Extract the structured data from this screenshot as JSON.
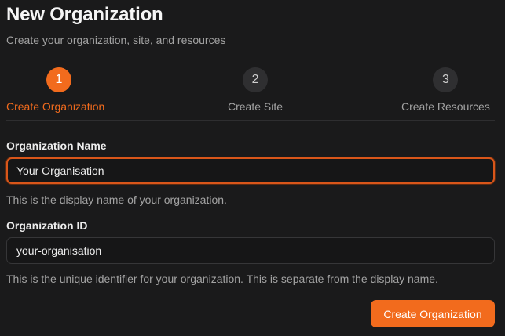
{
  "header": {
    "title": "New Organization",
    "subtitle": "Create your organization, site, and resources"
  },
  "steps": [
    {
      "number": "1",
      "label": "Create Organization",
      "active": true
    },
    {
      "number": "2",
      "label": "Create Site",
      "active": false
    },
    {
      "number": "3",
      "label": "Create Resources",
      "active": false
    }
  ],
  "form": {
    "org_name": {
      "label": "Organization Name",
      "value": "Your Organisation",
      "help": "This is the display name of your organization."
    },
    "org_id": {
      "label": "Organization ID",
      "value": "your-organisation",
      "help": "This is the unique identifier for your organization. This is separate from the display name."
    },
    "submit_label": "Create Organization"
  },
  "colors": {
    "accent": "#f26b1d",
    "background": "#1a1a1b",
    "inactive_step": "#2f2f31"
  }
}
